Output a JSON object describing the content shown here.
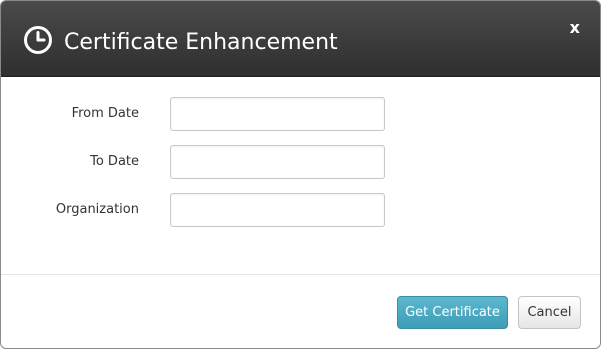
{
  "dialog": {
    "title": "Certificate Enhancement",
    "close_label": "x",
    "title_icon": "clock-icon"
  },
  "form": {
    "from_date": {
      "label": "From Date",
      "value": "",
      "placeholder": ""
    },
    "to_date": {
      "label": "To Date",
      "value": "",
      "placeholder": ""
    },
    "organization": {
      "label": "Organization",
      "value": "",
      "placeholder": ""
    }
  },
  "footer": {
    "submit_label": "Get Certificate",
    "cancel_label": "Cancel"
  },
  "colors": {
    "header_bg": "#3a3a3a",
    "primary_button": "#4aa8c2",
    "text": "#333333"
  }
}
